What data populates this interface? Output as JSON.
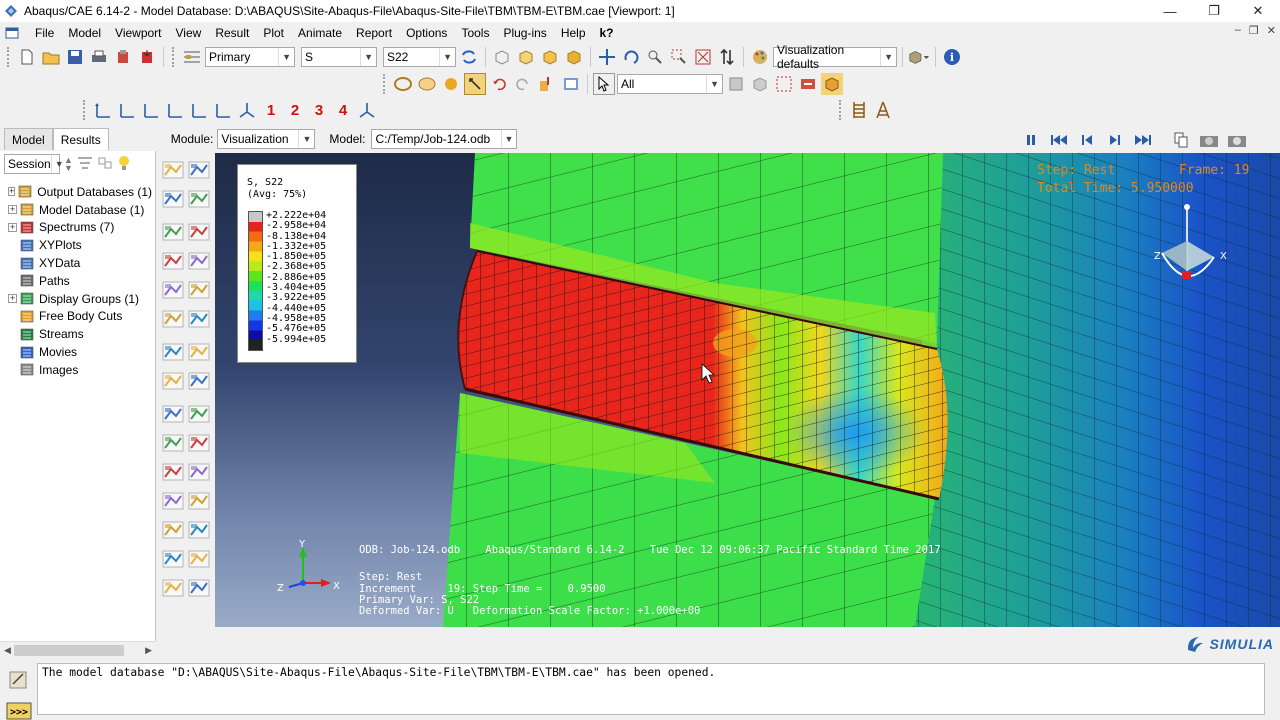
{
  "window": {
    "title": "Abaqus/CAE 6.14-2 - Model Database: D:\\ABAQUS\\Site-Abaqus-File\\Abaqus-Site-File\\TBM\\TBM-E\\TBM.cae [Viewport: 1]",
    "minimize": "—",
    "maximize": "❐",
    "close": "✕"
  },
  "menu": {
    "items": [
      "File",
      "Model",
      "Viewport",
      "View",
      "Result",
      "Plot",
      "Animate",
      "Report",
      "Options",
      "Tools",
      "Plug-ins",
      "Help",
      "k?"
    ],
    "mdi": [
      "–",
      "❐",
      "✕"
    ]
  },
  "toolbar": {
    "step_mode": "Primary",
    "variable": "S",
    "component": "S22",
    "visualization": "Visualization defaults",
    "selection": "All",
    "view_numbers": [
      "1",
      "2",
      "3",
      "4"
    ]
  },
  "module_row": {
    "tabs": [
      "Model",
      "Results"
    ],
    "active_tab": "Results",
    "module_label": "Module:",
    "module_value": "Visualization",
    "model_label": "Model:",
    "model_value": "C:/Temp/Job-124.odb"
  },
  "session": {
    "value": "Session"
  },
  "tree": [
    {
      "label": "Output Databases (1)",
      "expandable": true,
      "icon": "database-icon"
    },
    {
      "label": "Model Database (1)",
      "expandable": true,
      "icon": "model-database-icon"
    },
    {
      "label": "Spectrums (7)",
      "expandable": true,
      "icon": "spectrum-icon"
    },
    {
      "label": "XYPlots",
      "expandable": false,
      "icon": "xyplot-icon"
    },
    {
      "label": "XYData",
      "expandable": false,
      "icon": "xydata-icon"
    },
    {
      "label": "Paths",
      "expandable": false,
      "icon": "path-icon"
    },
    {
      "label": "Display Groups (1)",
      "expandable": true,
      "icon": "display-group-icon"
    },
    {
      "label": "Free Body Cuts",
      "expandable": false,
      "icon": "free-body-cut-icon"
    },
    {
      "label": "Streams",
      "expandable": false,
      "icon": "stream-icon"
    },
    {
      "label": "Movies",
      "expandable": false,
      "icon": "movie-icon"
    },
    {
      "label": "Images",
      "expandable": false,
      "icon": "image-icon"
    }
  ],
  "legend": {
    "title1": "S, S22",
    "title2": "(Avg: 75%)",
    "values": [
      "+2.222e+04",
      "-2.958e+04",
      "-8.138e+04",
      "-1.332e+05",
      "-1.850e+05",
      "-2.368e+05",
      "-2.886e+05",
      "-3.404e+05",
      "-3.922e+05",
      "-4.440e+05",
      "-4.958e+05",
      "-5.476e+05",
      "-5.994e+05"
    ],
    "colors": [
      "#c8c8c8",
      "#e8241a",
      "#f26a12",
      "#f6a815",
      "#f4e01c",
      "#b7ea18",
      "#5ee51c",
      "#1ee05a",
      "#1ed8b0",
      "#1ec0e8",
      "#1e7cf0",
      "#1438e0",
      "#0c0ca8",
      "#222222"
    ]
  },
  "viewport": {
    "step_label": "Step: Rest",
    "frame_label": "Frame: 19",
    "total_time": "Total Time: 5.950000",
    "info_line": "ODB: Job-124.odb    Abaqus/Standard 6.14-2    Tue Dec 12 09:06:37 Pacific Standard Time 2017",
    "step_line": "Step: Rest",
    "increment_line": "Increment     19: Step Time =    0.9500",
    "primary_line": "Primary Var: S, S22",
    "deformed_line": "Deformed Var: U   Deformation Scale Factor: +1.000e+00",
    "triad_y": "Y",
    "triad_x": "X",
    "triad_z": "Z",
    "view_triad_x": "X",
    "view_triad_z": "Z"
  },
  "message": "The model database \"D:\\ABAQUS\\Site-Abaqus-File\\Abaqus-Site-File\\TBM\\TBM-E\\TBM.cae\" has been opened.",
  "brand": "SIMULIA"
}
